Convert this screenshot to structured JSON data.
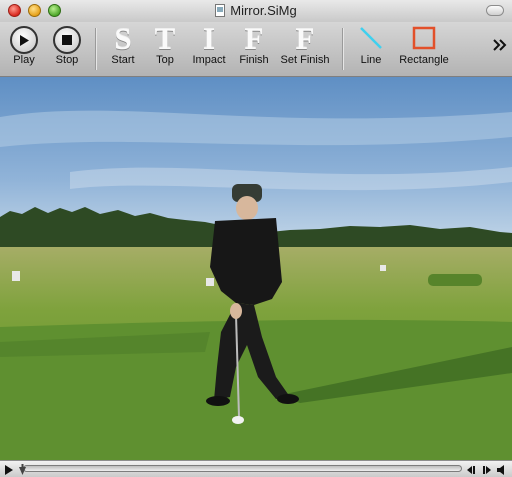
{
  "window": {
    "title": "Mirror.SiMg"
  },
  "toolbar": {
    "play": {
      "label": "Play",
      "icon": "play-icon"
    },
    "stop": {
      "label": "Stop",
      "icon": "stop-icon"
    },
    "start": {
      "label": "Start",
      "glyph": "S"
    },
    "top": {
      "label": "Top",
      "glyph": "T"
    },
    "impact": {
      "label": "Impact",
      "glyph": "I"
    },
    "finish": {
      "label": "Finish",
      "glyph": "F"
    },
    "set_finish": {
      "label": "Set Finish",
      "glyph": "F"
    },
    "line": {
      "label": "Line",
      "icon": "line-icon",
      "color": "#3fd0ee"
    },
    "rectangle": {
      "label": "Rectangle",
      "icon": "rectangle-icon",
      "color": "#e2502a"
    },
    "overflow_icon": "double-chevron-icon"
  },
  "video": {
    "content": "golfer-address-position-on-driving-range"
  },
  "controller": {
    "position": 0.0,
    "icons": [
      "play-icon",
      "step-back-icon",
      "step-forward-icon",
      "volume-icon"
    ]
  }
}
